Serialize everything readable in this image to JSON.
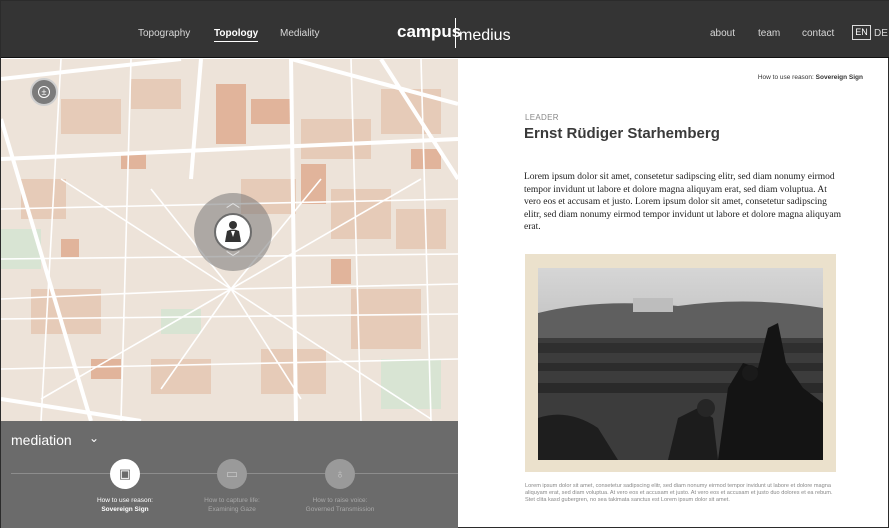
{
  "header": {
    "nav_left": [
      {
        "label": "Topography",
        "active": false
      },
      {
        "label": "Topology",
        "active": true
      },
      {
        "label": "Mediality",
        "active": false
      }
    ],
    "brand": {
      "part1": "campus",
      "part2": "medius"
    },
    "nav_right": [
      "about",
      "team",
      "contact"
    ],
    "lang": {
      "current": "EN",
      "other": "DE"
    }
  },
  "map": {
    "zoom_icon": "zoom-control-icon",
    "focus_icon": "person-figure-icon",
    "up_icon": "chevron-up-icon",
    "down_icon": "chevron-down-icon",
    "colors": {
      "background": "#ede3d9",
      "roads": "#ffffff",
      "buildings": "#e3bfa8"
    }
  },
  "mediation": {
    "title": "mediation",
    "steps": [
      {
        "line1": "How to use reason:",
        "line2": "Sovereign Sign",
        "icon": "sign-icon",
        "active": true
      },
      {
        "line1": "How to capture life:",
        "line2": "Examining Gaze",
        "icon": "gaze-icon",
        "active": false
      },
      {
        "line1": "How to raise voice:",
        "line2": "Governed Transmission",
        "icon": "transmission-icon",
        "active": false
      }
    ]
  },
  "content": {
    "breadcrumb_prefix": "How to use reason:",
    "breadcrumb_value": "Sovereign Sign",
    "kicker": "LEADER",
    "title": "Ernst Rüdiger Starhemberg",
    "body": "Lorem ipsum dolor sit amet, consetetur sadipscing elitr, sed diam nonumy eirmod tempor invidunt ut labore et dolore magna aliquyam erat, sed diam voluptua. At vero eos et accusam et justo. Lorem ipsum dolor sit amet, consetetur sadipscing elitr, sed diam nonumy eirmod tempor invidunt ut labore et dolore magna aliquyam erat.",
    "caption": "Lorem ipsum dolor sit amet, consetetur sadipscing elitr, sed diam nonumy eirmod tempor invidunt ut labore et dolore magna aliquyam erat, sed diam voluptua. At vero eos et accusam et justo. At vero eos et accusam et justo duo dolores et ea rebum. Stet clita kasd gubergren, no sea takimata sanctus est Lorem ipsum dolor sit amet."
  }
}
